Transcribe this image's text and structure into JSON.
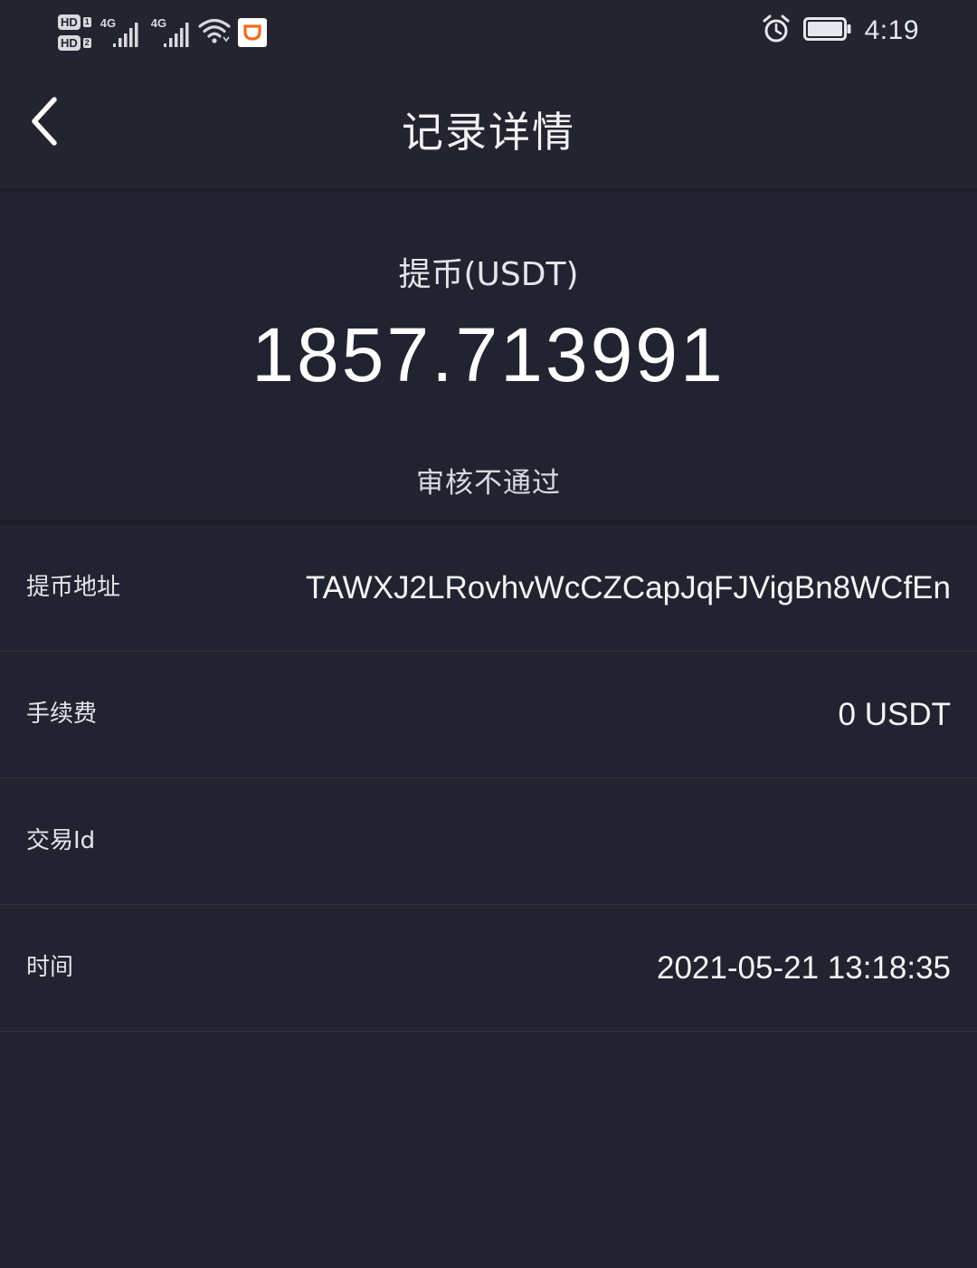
{
  "status_bar": {
    "sim_1_label": "HD",
    "sim_1_slot": "1",
    "sim_2_label": "HD",
    "sim_2_slot": "2",
    "signal_1_tag": "4G",
    "signal_2_tag": "4G",
    "icons": [
      "hd-icon",
      "signal-icon",
      "wifi-icon",
      "app-notification-icon",
      "alarm-icon",
      "battery-icon"
    ],
    "app_badge_color": "#f26b22",
    "time": "4:19"
  },
  "nav": {
    "back_icon": "chevron-left-icon",
    "title": "记录详情"
  },
  "summary": {
    "type_label": "提币(USDT)",
    "amount": "1857.713991",
    "status": "审核不通过"
  },
  "details": [
    {
      "label": "提币地址",
      "value": "TAWXJ2LRovhvWcCZCapJqFJVigBn8WCfEn"
    },
    {
      "label": "手续费",
      "value": "0 USDT"
    },
    {
      "label": "交易Id",
      "value": ""
    },
    {
      "label": "时间",
      "value": "2021-05-21 13:18:35"
    }
  ],
  "colors": {
    "background": "#222330",
    "divider": "#32333f",
    "text": "#ffffff"
  }
}
